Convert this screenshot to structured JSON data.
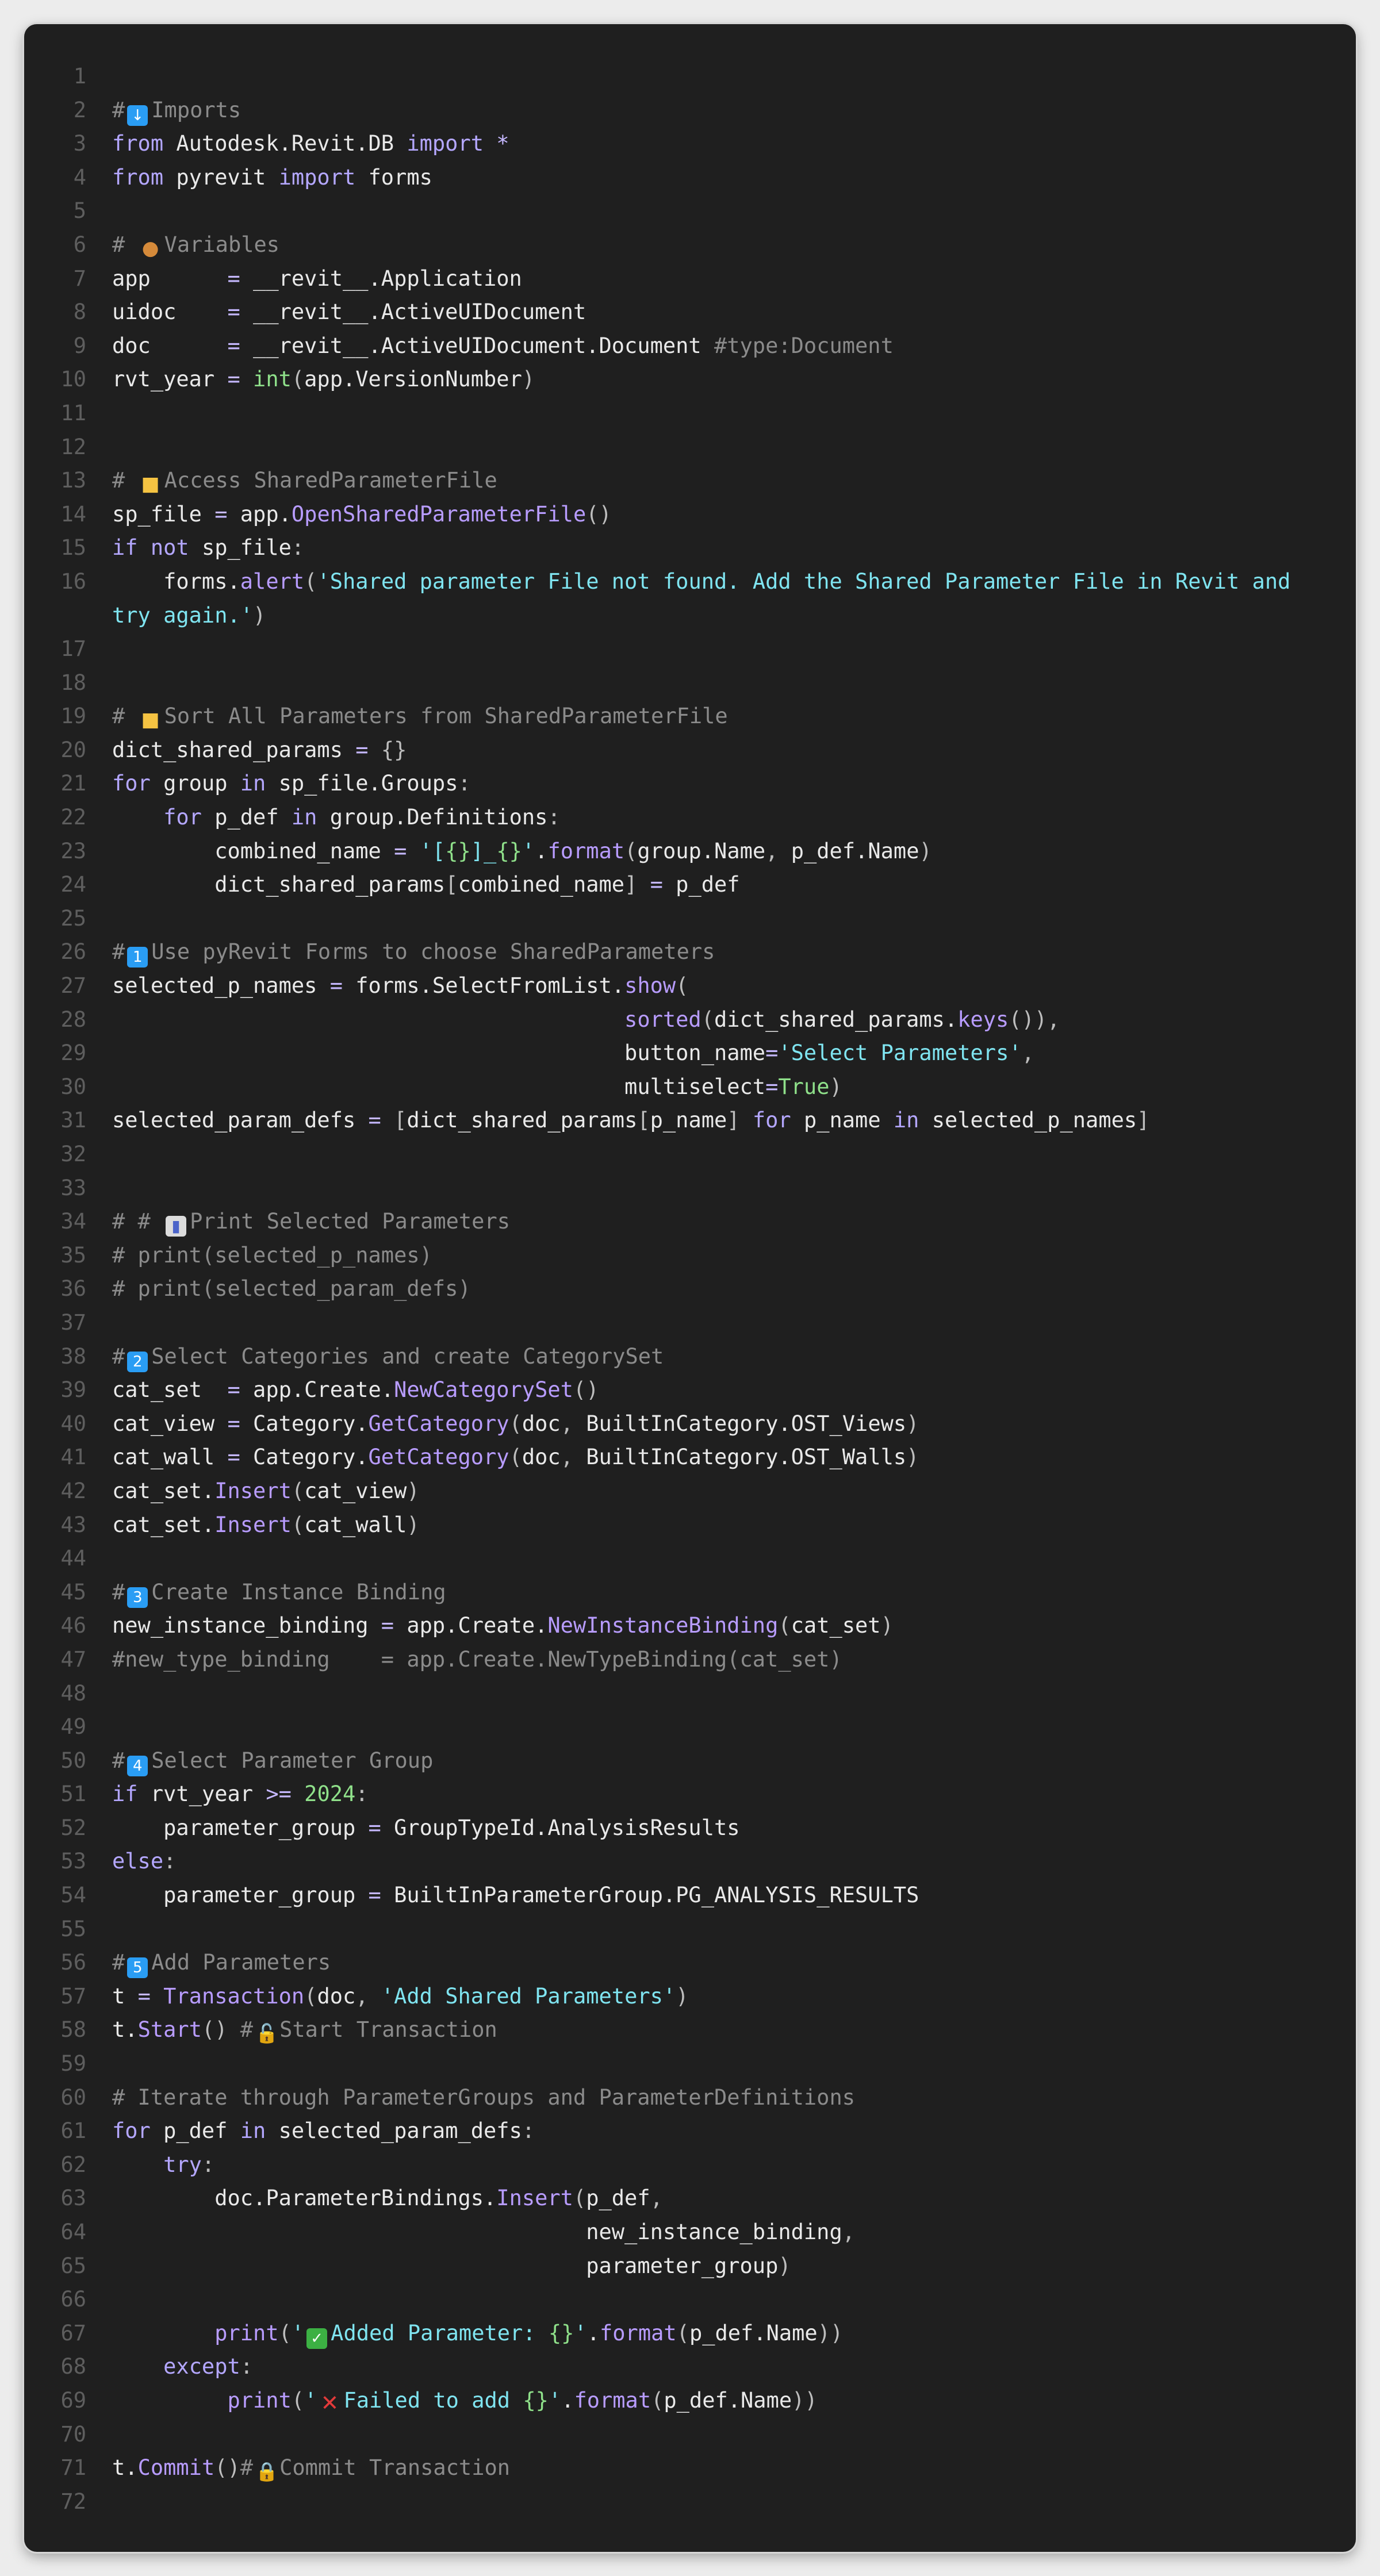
{
  "editor": {
    "lines": [
      {
        "n": "1",
        "html": ""
      },
      {
        "n": "2",
        "html": "<span class='c'>#<span class='emoji e-blue' data-name='down-arrow-icon' data-interactable='false'>↓</span>Imports</span>"
      },
      {
        "n": "3",
        "html": "<span class='k'>from</span> Autodesk.Revit.DB <span class='k'>import</span> <span class='o'>*</span>"
      },
      {
        "n": "4",
        "html": "<span class='k'>from</span> pyrevit <span class='k'>import</span> forms"
      },
      {
        "n": "5",
        "html": ""
      },
      {
        "n": "6",
        "html": "<span class='c'># <span class='emoji e-cookie' data-name='cookie-icon' data-interactable='false'>●</span>Variables</span>"
      },
      {
        "n": "7",
        "html": "app      <span class='o'>=</span> __revit__.Application"
      },
      {
        "n": "8",
        "html": "uidoc    <span class='o'>=</span> __revit__.ActiveUIDocument"
      },
      {
        "n": "9",
        "html": "doc      <span class='o'>=</span> __revit__.ActiveUIDocument.Document <span class='c'>#type:Document</span>"
      },
      {
        "n": "10",
        "html": "rvt_year <span class='o'>=</span> <span class='n'>int</span><span class='p'>(</span>app.VersionNumber<span class='p'>)</span>"
      },
      {
        "n": "11",
        "html": ""
      },
      {
        "n": "12",
        "html": ""
      },
      {
        "n": "13",
        "html": "<span class='c'># <span class='emoji e-folder' data-name='folder-icon' data-interactable='false'>■</span>Access SharedParameterFile</span>"
      },
      {
        "n": "14",
        "html": "sp_file <span class='o'>=</span> app.<span class='f'>OpenSharedParameterFile</span><span class='p'>()</span>"
      },
      {
        "n": "15",
        "html": "<span class='k'>if</span> <span class='k'>not</span> sp_file<span class='p'>:</span>"
      },
      {
        "n": "16",
        "tall": true,
        "html": "    forms.<span class='f'>alert</span><span class='p'>(</span><span class='s'>'Shared parameter File not found. Add the Shared Parameter File in Revit and try again.'</span><span class='p'>)</span>"
      },
      {
        "n": "17",
        "html": ""
      },
      {
        "n": "18",
        "html": ""
      },
      {
        "n": "19",
        "html": "<span class='c'># <span class='emoji e-folder' data-name='open-folder-icon' data-interactable='false'>■</span>Sort All Parameters from SharedParameterFile</span>"
      },
      {
        "n": "20",
        "html": "dict_shared_params <span class='o'>=</span> <span class='p'>{}</span>"
      },
      {
        "n": "21",
        "html": "<span class='k'>for</span> group <span class='k'>in</span> sp_file.Groups<span class='p'>:</span>"
      },
      {
        "n": "22",
        "html": "    <span class='k'>for</span> p_def <span class='k'>in</span> group.Definitions<span class='p'>:</span>"
      },
      {
        "n": "23",
        "html": "        combined_name <span class='o'>=</span> <span class='s'>'[</span><span class='n'>{}</span><span class='s'>]_</span><span class='n'>{}</span><span class='s'>'</span>.<span class='f'>format</span><span class='p'>(</span>group.Name<span class='p'>,</span> p_def.Name<span class='p'>)</span>"
      },
      {
        "n": "24",
        "html": "        dict_shared_params<span class='p'>[</span>combined_name<span class='p'>]</span> <span class='o'>=</span> p_def"
      },
      {
        "n": "25",
        "html": ""
      },
      {
        "n": "26",
        "html": "<span class='c'>#<span class='emoji e-blue' data-name='keycap-1-icon' data-interactable='false'>1</span>Use pyRevit Forms to choose SharedParameters</span>"
      },
      {
        "n": "27",
        "html": "selected_p_names <span class='o'>=</span> forms.SelectFromList.<span class='f'>show</span><span class='p'>(</span>"
      },
      {
        "n": "28",
        "html": "                                        <span class='f'>sorted</span><span class='p'>(</span>dict_shared_params.<span class='f'>keys</span><span class='p'>()),</span>"
      },
      {
        "n": "29",
        "html": "                                        button_name<span class='o'>=</span><span class='s'>'Select Parameters'</span><span class='p'>,</span>"
      },
      {
        "n": "30",
        "html": "                                        multiselect<span class='o'>=</span><span class='n'>True</span><span class='p'>)</span>"
      },
      {
        "n": "31",
        "html": "selected_param_defs <span class='o'>=</span> <span class='p'>[</span>dict_shared_params<span class='p'>[</span>p_name<span class='p'>]</span> <span class='k'>for</span> p_name <span class='k'>in</span> selected_p_names<span class='p'>]</span>"
      },
      {
        "n": "32",
        "html": ""
      },
      {
        "n": "33",
        "html": ""
      },
      {
        "n": "34",
        "html": "<span class='c'># # <span class='emoji e-chart' data-name='bar-chart-icon' data-interactable='false'>▮</span>Print Selected Parameters</span>"
      },
      {
        "n": "35",
        "html": "<span class='c'># print(selected_p_names)</span>"
      },
      {
        "n": "36",
        "html": "<span class='c'># print(selected_param_defs)</span>"
      },
      {
        "n": "37",
        "html": ""
      },
      {
        "n": "38",
        "html": "<span class='c'>#<span class='emoji e-blue' data-name='keycap-2-icon' data-interactable='false'>2</span>Select Categories and create CategorySet</span>"
      },
      {
        "n": "39",
        "html": "cat_set  <span class='o'>=</span> app.Create.<span class='f'>NewCategorySet</span><span class='p'>()</span>"
      },
      {
        "n": "40",
        "html": "cat_view <span class='o'>=</span> Category.<span class='f'>GetCategory</span><span class='p'>(</span>doc<span class='p'>,</span> BuiltInCategory.OST_Views<span class='p'>)</span>"
      },
      {
        "n": "41",
        "html": "cat_wall <span class='o'>=</span> Category.<span class='f'>GetCategory</span><span class='p'>(</span>doc<span class='p'>,</span> BuiltInCategory.OST_Walls<span class='p'>)</span>"
      },
      {
        "n": "42",
        "html": "cat_set.<span class='f'>Insert</span><span class='p'>(</span>cat_view<span class='p'>)</span>"
      },
      {
        "n": "43",
        "html": "cat_set.<span class='f'>Insert</span><span class='p'>(</span>cat_wall<span class='p'>)</span>"
      },
      {
        "n": "44",
        "html": ""
      },
      {
        "n": "45",
        "html": "<span class='c'>#<span class='emoji e-blue' data-name='keycap-3-icon' data-interactable='false'>3</span>Create Instance Binding</span>"
      },
      {
        "n": "46",
        "html": "new_instance_binding <span class='o'>=</span> app.Create.<span class='f'>NewInstanceBinding</span><span class='p'>(</span>cat_set<span class='p'>)</span>"
      },
      {
        "n": "47",
        "html": "<span class='c'>#new_type_binding    = app.Create.NewTypeBinding(cat_set)</span>"
      },
      {
        "n": "48",
        "html": ""
      },
      {
        "n": "49",
        "html": ""
      },
      {
        "n": "50",
        "html": "<span class='c'>#<span class='emoji e-blue' data-name='keycap-4-icon' data-interactable='false'>4</span>Select Parameter Group</span>"
      },
      {
        "n": "51",
        "html": "<span class='k'>if</span> rvt_year <span class='o'>&gt;=</span> <span class='n'>2024</span><span class='p'>:</span>"
      },
      {
        "n": "52",
        "html": "    parameter_group <span class='o'>=</span> GroupTypeId.AnalysisResults"
      },
      {
        "n": "53",
        "html": "<span class='k'>else</span><span class='p'>:</span>"
      },
      {
        "n": "54",
        "html": "    parameter_group <span class='o'>=</span> BuiltInParameterGroup.PG_ANALYSIS_RESULTS"
      },
      {
        "n": "55",
        "html": ""
      },
      {
        "n": "56",
        "html": "<span class='c'>#<span class='emoji e-blue' data-name='keycap-5-icon' data-interactable='false'>5</span>Add Parameters</span>"
      },
      {
        "n": "57",
        "html": "t <span class='o'>=</span> <span class='f'>Transaction</span><span class='p'>(</span>doc<span class='p'>,</span> <span class='s'>'Add Shared Parameters'</span><span class='p'>)</span>"
      },
      {
        "n": "58",
        "html": "t.<span class='f'>Start</span><span class='p'>()</span> <span class='c'>#<span class='emoji e-lock' data-name='unlocked-icon' data-interactable='false'>🔓</span>Start Transaction</span>"
      },
      {
        "n": "59",
        "html": ""
      },
      {
        "n": "60",
        "html": "<span class='c'># Iterate through ParameterGroups and ParameterDefinitions</span>"
      },
      {
        "n": "61",
        "html": "<span class='k'>for</span> p_def <span class='k'>in</span> selected_param_defs<span class='p'>:</span>"
      },
      {
        "n": "62",
        "html": "    <span class='k'>try</span><span class='p'>:</span>"
      },
      {
        "n": "63",
        "html": "        doc.ParameterBindings.<span class='f'>Insert</span><span class='p'>(</span>p_def<span class='p'>,</span>"
      },
      {
        "n": "64",
        "html": "                                     new_instance_binding<span class='p'>,</span>"
      },
      {
        "n": "65",
        "html": "                                     parameter_group<span class='p'>)</span>"
      },
      {
        "n": "66",
        "html": ""
      },
      {
        "n": "67",
        "html": "        <span class='f'>print</span><span class='p'>(</span><span class='s'>'<span class='emoji e-green' data-name='check-mark-icon' data-interactable='false'>✓</span>Added Parameter: </span><span class='n'>{}</span><span class='s'>'</span>.<span class='f'>format</span><span class='p'>(</span>p_def.Name<span class='p'>))</span>"
      },
      {
        "n": "68",
        "html": "    <span class='k'>except</span><span class='p'>:</span>"
      },
      {
        "n": "69",
        "html": "         <span class='f'>print</span><span class='p'>(</span><span class='s'>'<span class='emoji e-cross' data-name='cross-mark-icon' data-interactable='false'>✕</span>Failed to add </span><span class='n'>{}</span><span class='s'>'</span>.<span class='f'>format</span><span class='p'>(</span>p_def.Name<span class='p'>))</span>"
      },
      {
        "n": "70",
        "html": ""
      },
      {
        "n": "71",
        "html": "t.<span class='f'>Commit</span><span class='p'>()</span><span class='c'>#<span class='emoji e-lock' data-name='locked-icon' data-interactable='false'>🔒</span>Commit Transaction</span>"
      },
      {
        "n": "72",
        "html": ""
      }
    ]
  }
}
